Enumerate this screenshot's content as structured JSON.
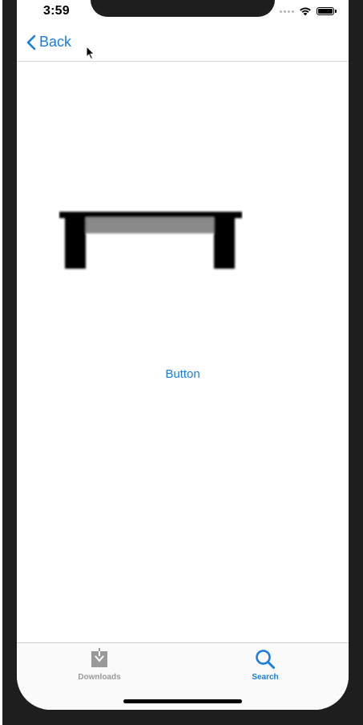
{
  "status_bar": {
    "time": "3:59"
  },
  "nav": {
    "back_label": "Back",
    "back_icon": "chevron-left-icon"
  },
  "content": {
    "image_icon": "table-icon",
    "button_label": "Button"
  },
  "tab_bar": {
    "tabs": [
      {
        "label": "Downloads",
        "icon": "download-icon",
        "selected": false
      },
      {
        "label": "Search",
        "icon": "search-icon",
        "selected": true
      }
    ]
  },
  "colors": {
    "accent": "#1a7de0",
    "inactive_tab": "#9a9a9a"
  }
}
